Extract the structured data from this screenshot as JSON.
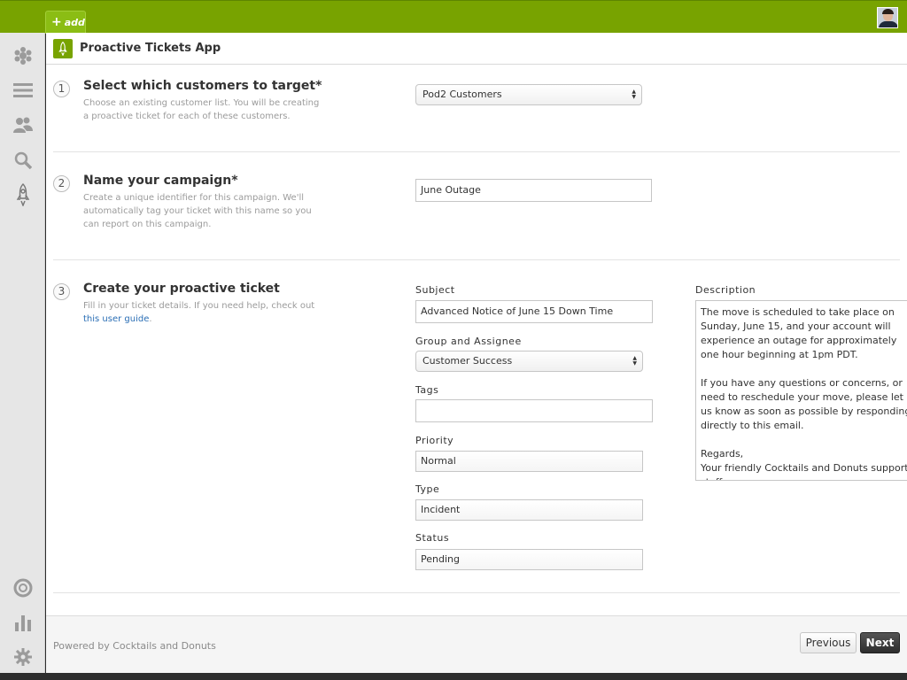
{
  "topbar": {
    "add_label": "add"
  },
  "app": {
    "title": "Proactive Tickets App"
  },
  "steps": [
    {
      "number": "1",
      "title": "Select which customers to target*",
      "description": "Choose an existing customer list. You will be creating a proactive ticket for each of these customers.",
      "customer_list_value": "Pod2 Customers"
    },
    {
      "number": "2",
      "title": "Name your campaign*",
      "description": "Create a unique identifier for this campaign. We'll automatically tag your ticket with this name so you can report on this campaign.",
      "campaign_name_value": "June Outage"
    },
    {
      "number": "3",
      "title": "Create your proactive ticket",
      "description_prefix": "Fill in your ticket details. If you need help, check out ",
      "description_link": "this user guide",
      "description_suffix": "."
    }
  ],
  "ticket": {
    "subject_label": "Subject",
    "subject_value": "Advanced Notice of June 15 Down Time",
    "group_label": "Group and Assignee",
    "group_value": "Customer Success",
    "tags_label": "Tags",
    "tags_value": "",
    "priority_label": "Priority",
    "priority_value": "Normal",
    "type_label": "Type",
    "type_value": "Incident",
    "status_label": "Status",
    "status_value": "Pending",
    "description_label": "Description",
    "description_value": "The move is scheduled to take place on Sunday, June 15, and your account will experience an outage for approximately one hour beginning at 1pm PDT.\n\nIf you have any questions or concerns, or need to reschedule your move, please let us know as soon as possible by responding directly to this email.\n\nRegards,\nYour friendly Cocktails and Donuts support staff"
  },
  "footer": {
    "powered_by": "Powered by Cocktails and Donuts",
    "previous_label": "Previous",
    "next_label": "Next"
  },
  "colors": {
    "brand_green": "#78a300",
    "link_blue": "#2a6eb5",
    "next_button": "#333333"
  },
  "icons": {
    "sidebar_top": [
      "zendesk-logo-icon",
      "views-list-icon",
      "users-icon",
      "search-icon",
      "rocket-app-icon"
    ],
    "sidebar_bottom": [
      "help-lifebuoy-icon",
      "reporting-chart-icon",
      "admin-gear-icon"
    ]
  }
}
